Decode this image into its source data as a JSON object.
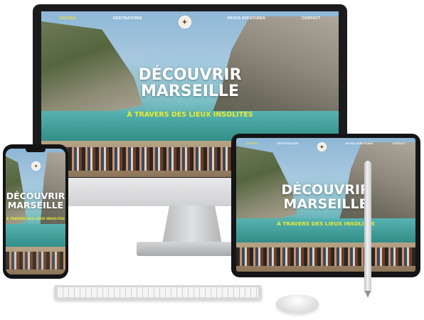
{
  "website": {
    "nav": {
      "home": "ACCUEIL",
      "destinations": "DESTINATIONS",
      "packs": "PACKS AVENTURES",
      "contact": "CONTACT"
    },
    "logo_icon": "compass-icon",
    "hero": {
      "title_line1": "DÉCOUVRIR",
      "title_line2": "MARSEILLE",
      "subtitle": "À TRAVERS DES LIEUX INSOLITES"
    },
    "colors": {
      "nav_active": "#f1e23c",
      "subtitle": "#e9ea34",
      "title": "#ffffff"
    }
  },
  "devices": {
    "desktop": "imac",
    "tablet": "tablet",
    "phone": "smartphone",
    "accessories": [
      "keyboard",
      "mouse",
      "stylus"
    ]
  }
}
